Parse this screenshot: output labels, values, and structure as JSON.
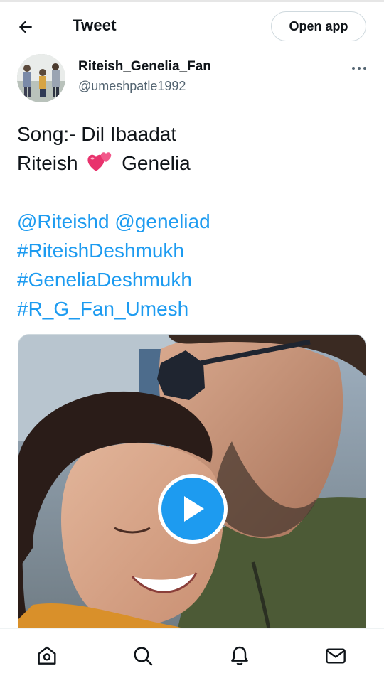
{
  "header": {
    "title": "Tweet",
    "open_app_label": "Open app"
  },
  "tweet": {
    "author": {
      "display_name": "Riteish_Genelia_Fan",
      "handle": "@umeshpatle1992"
    },
    "text": {
      "line1": "Song:- Dil Ibaadat",
      "line2_before": "Riteish",
      "line2_emoji": "revolving-hearts-emoji",
      "line2_after": "Genelia",
      "mention1": "@Riteishd",
      "mention2": "@geneliad",
      "hashtag1": "#RiteishDeshmukh",
      "hashtag2": "#GeneliaDeshmukh",
      "hashtag3": "#R_G_Fan_Umesh"
    },
    "media": {
      "type": "video",
      "icon": "play-icon"
    }
  },
  "bottom_nav": {
    "items": [
      {
        "icon": "home-icon"
      },
      {
        "icon": "search-icon"
      },
      {
        "icon": "notifications-bell-icon"
      },
      {
        "icon": "messages-envelope-icon"
      }
    ]
  },
  "colors": {
    "link": "#1d9bf0",
    "text": "#0f1419",
    "secondary": "#536471",
    "accent": "#1d9bf0"
  }
}
